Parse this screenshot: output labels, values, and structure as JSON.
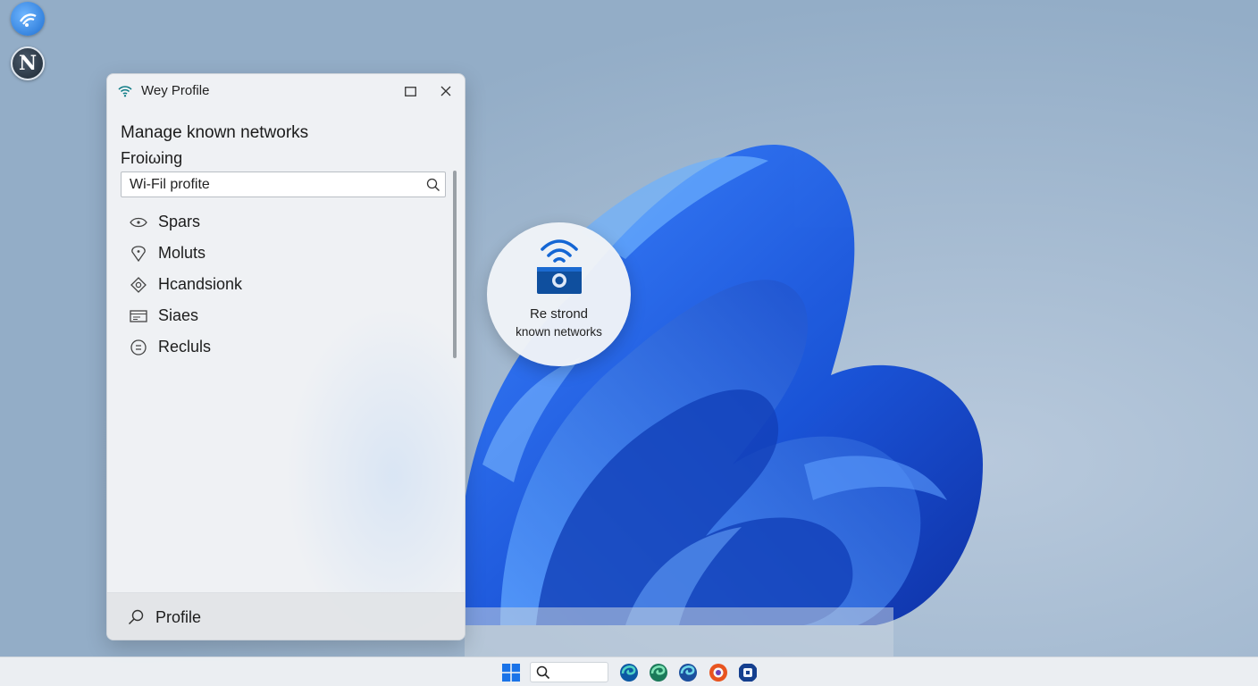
{
  "desktop": {
    "icons": [
      {
        "name": "wifi-app-icon"
      },
      {
        "name": "n-app-icon",
        "letter": "N"
      }
    ]
  },
  "window": {
    "title": "Wey Profile",
    "heading": "Manage known networks",
    "subheading": "Froiωing",
    "search": {
      "value": "Wi-Fil profite",
      "placeholder": ""
    },
    "items": [
      {
        "label": "Spars",
        "icon": "eye-icon"
      },
      {
        "label": "Moluts",
        "icon": "location-pin-icon"
      },
      {
        "label": "Hcandsionk",
        "icon": "diamond-icon"
      },
      {
        "label": "Siaes",
        "icon": "card-icon"
      },
      {
        "label": "Recluls",
        "icon": "circle-badge-icon"
      }
    ],
    "footer_label": "Profile"
  },
  "bubble": {
    "line1": "Re strond",
    "line2": "known networks"
  },
  "taskbar": {
    "apps": [
      "edge-icon",
      "edge-dev-icon",
      "edge-beta-icon",
      "firefox-icon",
      "settings-app-icon"
    ]
  },
  "colors": {
    "accent": "#1f6fd1",
    "wallpaper_bloom": "#1e5be0",
    "wifi_teal": "#0e7c86"
  }
}
